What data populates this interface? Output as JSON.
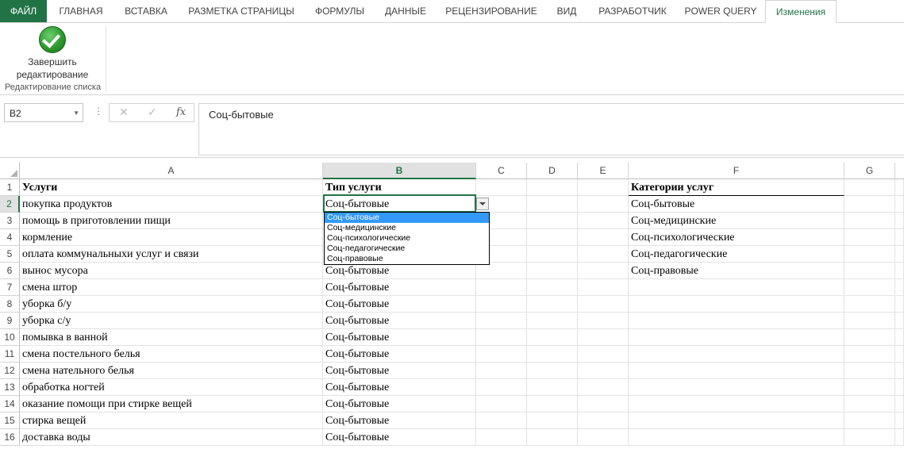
{
  "ribbon": {
    "tabs": [
      "ФАЙЛ",
      "ГЛАВНАЯ",
      "ВСТАВКА",
      "РАЗМЕТКА СТРАНИЦЫ",
      "ФОРМУЛЫ",
      "ДАННЫЕ",
      "РЕЦЕНЗИРОВАНИЕ",
      "ВИД",
      "РАЗРАБОТЧИК",
      "POWER QUERY",
      "Изменения"
    ],
    "active_tab": "Изменения",
    "finish_button_line1": "Завершить",
    "finish_button_line2": "редактирование",
    "group_label": "Редактирование списка"
  },
  "formula_bar": {
    "name_box": "B2",
    "fx_label": "fx",
    "value": "Соц-бытовые"
  },
  "grid": {
    "columns": [
      "A",
      "B",
      "C",
      "D",
      "E",
      "F",
      "G"
    ],
    "selected_column": "B",
    "selected_row": 2,
    "rows": [
      {
        "n": "1",
        "a": "Услуги",
        "b": "Тип услуги",
        "f": "Категории услуг"
      },
      {
        "n": "2",
        "a": "покупка продуктов",
        "b": "Соц-бытовые",
        "f": "Соц-бытовые"
      },
      {
        "n": "3",
        "a": "помощь в приготовлении пищи",
        "b": "",
        "f": "Соц-медицинские"
      },
      {
        "n": "4",
        "a": "кормление",
        "b": "",
        "f": "Соц-психологические"
      },
      {
        "n": "5",
        "a": "оплата коммунальныхи услуг и связи",
        "b": "",
        "f": "Соц-педагогические"
      },
      {
        "n": "6",
        "a": "вынос мусора",
        "b": "Соц-бытовые",
        "f": "Соц-правовые"
      },
      {
        "n": "7",
        "a": "смена штор",
        "b": "Соц-бытовые",
        "f": ""
      },
      {
        "n": "8",
        "a": "уборка б/у",
        "b": "Соц-бытовые",
        "f": ""
      },
      {
        "n": "9",
        "a": "уборка с/у",
        "b": "Соц-бытовые",
        "f": ""
      },
      {
        "n": "10",
        "a": "помывка в ванной",
        "b": "Соц-бытовые",
        "f": ""
      },
      {
        "n": "11",
        "a": "смена постельного белья",
        "b": "Соц-бытовые",
        "f": ""
      },
      {
        "n": "12",
        "a": "смена нательного белья",
        "b": "Соц-бытовые",
        "f": ""
      },
      {
        "n": "13",
        "a": "обработка ногтей",
        "b": "Соц-бытовые",
        "f": ""
      },
      {
        "n": "14",
        "a": "оказание помощи при стирке вещей",
        "b": "Соц-бытовые",
        "f": ""
      },
      {
        "n": "15",
        "a": "стирка вещей",
        "b": "Соц-бытовые",
        "f": ""
      },
      {
        "n": "16",
        "a": "доставка воды",
        "b": "Соц-бытовые",
        "f": ""
      }
    ]
  },
  "dropdown": {
    "options": [
      "Соц-бытовые",
      "Соц-медицинские",
      "Соц-психологические",
      "Соц-педагогические",
      "Соц-правовые"
    ],
    "highlighted": "Соц-бытовые"
  }
}
